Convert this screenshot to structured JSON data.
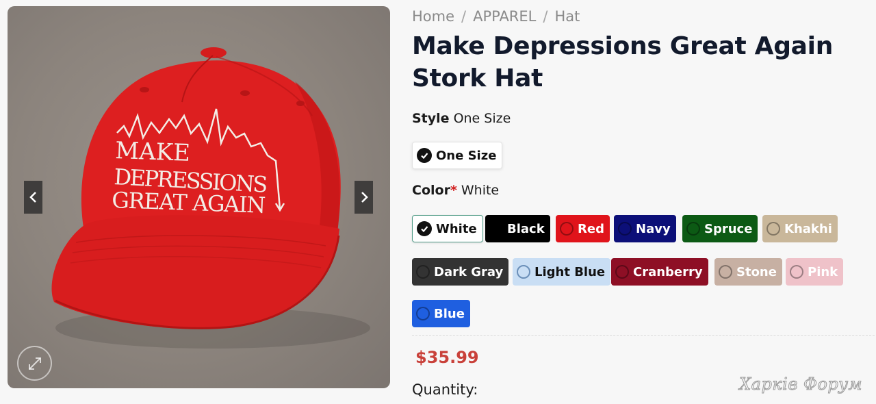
{
  "breadcrumb": {
    "home": "Home",
    "category": "APPAREL",
    "subcategory": "Hat"
  },
  "product": {
    "title": "Make Depressions Great Again Stork Hat",
    "cap_text": [
      "MAKE",
      "DEPRESSIONS",
      "GREAT AGAIN"
    ],
    "price": "$35.99",
    "quantity_label": "Quantity:"
  },
  "style": {
    "label": "Style",
    "value": "One Size",
    "options": [
      "One Size"
    ]
  },
  "color": {
    "label": "Color",
    "required_mark": "*",
    "value": "White",
    "options": [
      {
        "label": "White",
        "swatch": "#ffffff",
        "selected": true
      },
      {
        "label": "Black",
        "swatch": "#000000"
      },
      {
        "label": "Red",
        "swatch": "#e0141b"
      },
      {
        "label": "Navy",
        "swatch": "#0c0f78"
      },
      {
        "label": "Spruce",
        "swatch": "#0c5a14"
      },
      {
        "label": "Khakhi",
        "swatch": "#c9b79a"
      },
      {
        "label": "Dark Gray",
        "swatch": "#333333"
      },
      {
        "label": "Light Blue",
        "swatch": "#c9def4"
      },
      {
        "label": "Cranberry",
        "swatch": "#8e0f25"
      },
      {
        "label": "Stone",
        "swatch": "#c7b0a3"
      },
      {
        "label": "Pink",
        "swatch": "#efc2c9"
      },
      {
        "label": "Blue",
        "swatch": "#1f5fe0"
      }
    ]
  },
  "colors": {
    "price": "#c9413a",
    "title": "#121a2c",
    "selected_border": "#4f9b86"
  },
  "watermark": "Харків Форум",
  "icons": {
    "prev": "chevron-left-icon",
    "next": "chevron-right-icon",
    "zoom": "expand-icon",
    "check": "check-icon"
  }
}
